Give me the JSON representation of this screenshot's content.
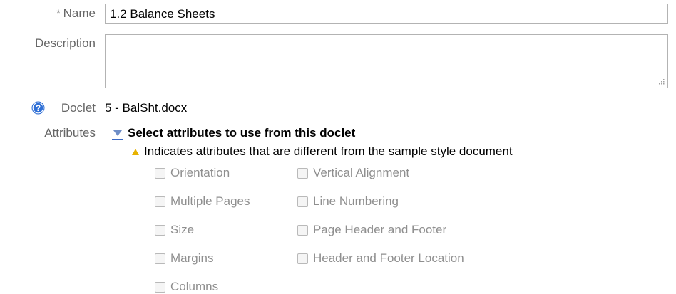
{
  "form": {
    "name": {
      "required_mark": "*",
      "label": "Name",
      "value": "1.2 Balance Sheets"
    },
    "description": {
      "label": "Description",
      "value": ""
    },
    "doclet": {
      "help_icon": "question-circle-icon",
      "label": "Doclet",
      "value": "5 - BalSht.docx"
    },
    "attributes": {
      "label": "Attributes",
      "section_title": "Select attributes to use from this doclet",
      "warning_icon": "warning-triangle-icon",
      "hint": "Indicates attributes that are different from the sample style document",
      "options": [
        {
          "label": "Orientation",
          "checked": false,
          "enabled": false
        },
        {
          "label": "Vertical Alignment",
          "checked": false,
          "enabled": false
        },
        {
          "label": "Multiple Pages",
          "checked": false,
          "enabled": false
        },
        {
          "label": "Line Numbering",
          "checked": false,
          "enabled": false
        },
        {
          "label": "Size",
          "checked": false,
          "enabled": false
        },
        {
          "label": "Page Header and Footer",
          "checked": false,
          "enabled": false
        },
        {
          "label": "Margins",
          "checked": false,
          "enabled": false
        },
        {
          "label": "Header and Footer Location",
          "checked": false,
          "enabled": false
        },
        {
          "label": "Columns",
          "checked": false,
          "enabled": false
        }
      ]
    }
  },
  "colors": {
    "label_gray": "#666666",
    "disabled_text": "#8f8f8f",
    "help_icon_blue": "#2f6fd6",
    "warning_yellow": "#e7b200",
    "disclosure_blue": "#6f8ec7",
    "input_border": "#b3b3b3"
  }
}
